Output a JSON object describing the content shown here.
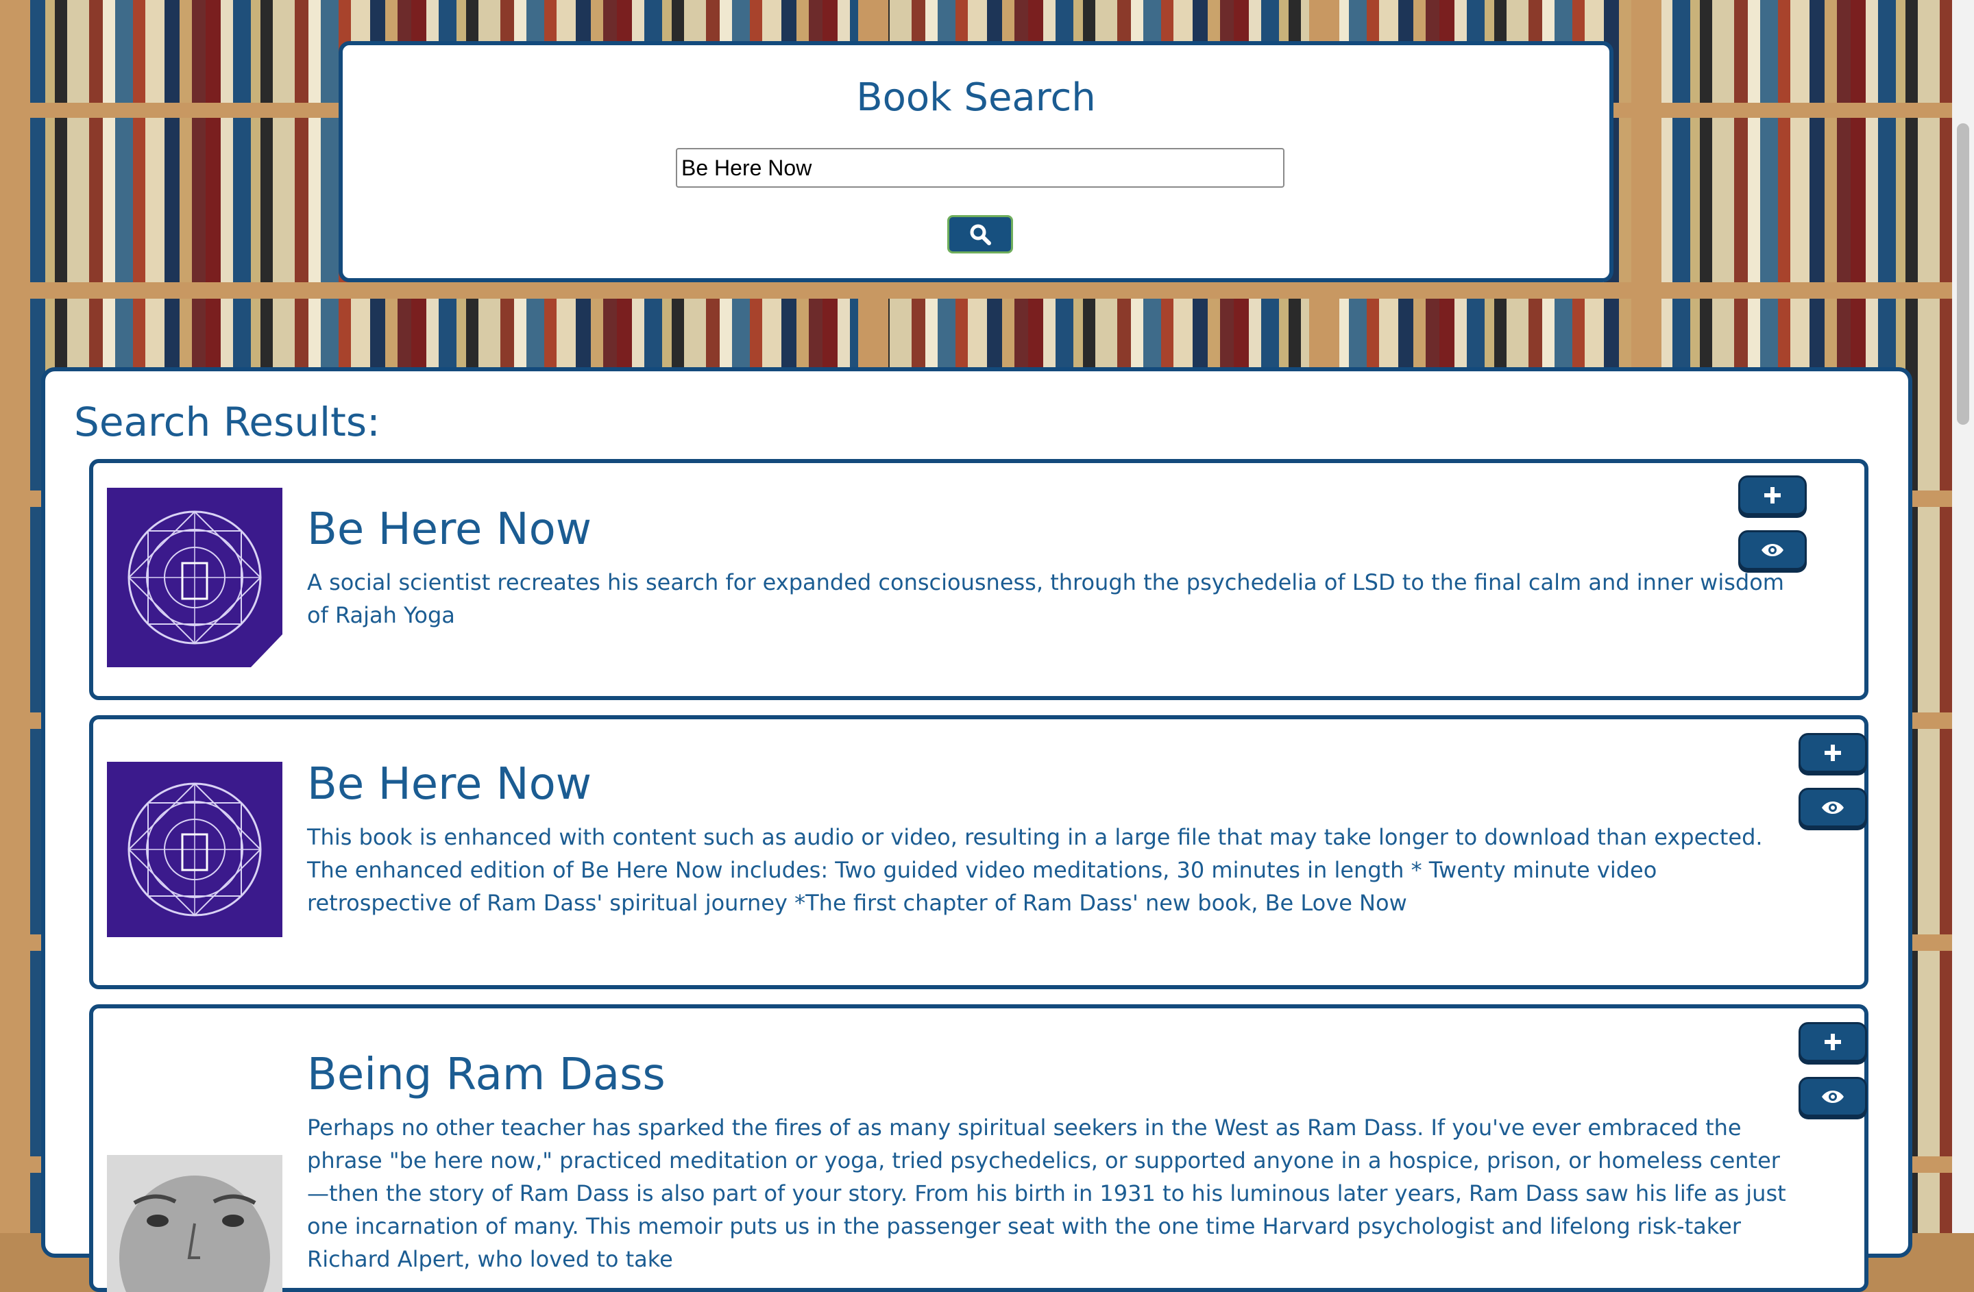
{
  "search": {
    "title": "Book Search",
    "query": "Be Here Now",
    "button_icon": "search-icon"
  },
  "results": {
    "heading": "Search Results:",
    "items": [
      {
        "title": "Be Here Now",
        "description": "A social scientist recreates his search for expanded consciousness, through the psychedelia of LSD to the final calm and inner wisdom of Rajah Yoga",
        "cover": "purple-mandala-cover"
      },
      {
        "title": "Be Here Now",
        "description": "This book is enhanced with content such as audio or video, resulting in a large file that may take longer to download than expected. The enhanced edition of Be Here Now includes: Two guided video meditations, 30 minutes in length * Twenty minute video retrospective of Ram Dass' spiritual journey *The first chapter of Ram Dass' new book, Be Love Now",
        "cover": "purple-mandala-cover"
      },
      {
        "title": "Being Ram Dass",
        "description": "Perhaps no other teacher has sparked the fires of as many spiritual seekers in the West as Ram Dass. If you've ever embraced the phrase \"be here now,\" practiced meditation or yoga, tried psychedelics, or supported anyone in a hospice, prison, or homeless center—then the story of Ram Dass is also part of your story. From his birth in 1931 to his luminous later years, Ram Dass saw his life as just one incarnation of many. This memoir puts us in the passenger seat with the one time Harvard psychologist and lifelong risk-taker Richard Alpert, who loved to take",
        "cover": "portrait-photo-cover"
      }
    ],
    "add_icon": "plus-icon",
    "view_icon": "eye-icon"
  },
  "colors": {
    "accent": "#1b5c92",
    "button": "#17507f",
    "border": "#134a7c"
  }
}
